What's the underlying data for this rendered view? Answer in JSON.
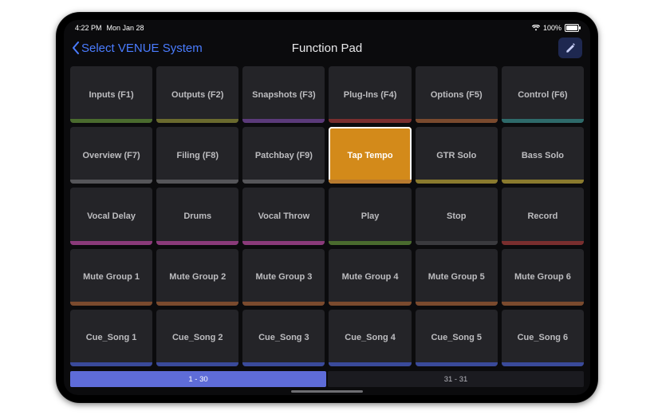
{
  "statusbar": {
    "time": "4:22 PM",
    "date": "Mon Jan 28",
    "battery_pct": "100%"
  },
  "nav": {
    "back_label": "Select VENUE System",
    "title": "Function Pad"
  },
  "colors": {
    "green": "#4a6b2e",
    "olive": "#6a6a2e",
    "purple": "#5b3a7a",
    "red": "#7a2e2e",
    "brown": "#7a4a2e",
    "teal": "#2e6a6a",
    "grey": "#555559",
    "yellow": "#8a7a2e",
    "orange": "#b87a2e",
    "magenta": "#8a3a7a",
    "darkgrey": "#3a3a3e",
    "blue": "#3a4a9a"
  },
  "pads": [
    {
      "label": "Inputs (F1)",
      "accent": "green"
    },
    {
      "label": "Outputs (F2)",
      "accent": "olive"
    },
    {
      "label": "Snapshots (F3)",
      "accent": "purple"
    },
    {
      "label": "Plug-Ins (F4)",
      "accent": "red"
    },
    {
      "label": "Options (F5)",
      "accent": "brown"
    },
    {
      "label": "Control (F6)",
      "accent": "teal"
    },
    {
      "label": "Overview (F7)",
      "accent": "grey"
    },
    {
      "label": "Filing (F8)",
      "accent": "grey"
    },
    {
      "label": "Patchbay (F9)",
      "accent": "grey"
    },
    {
      "label": "Tap Tempo",
      "accent": "orange",
      "selected": true
    },
    {
      "label": "GTR Solo",
      "accent": "yellow"
    },
    {
      "label": "Bass Solo",
      "accent": "yellow"
    },
    {
      "label": "Vocal Delay",
      "accent": "magenta"
    },
    {
      "label": "Drums",
      "accent": "magenta"
    },
    {
      "label": "Vocal Throw",
      "accent": "magenta"
    },
    {
      "label": "Play",
      "accent": "green"
    },
    {
      "label": "Stop",
      "accent": "darkgrey"
    },
    {
      "label": "Record",
      "accent": "red"
    },
    {
      "label": "Mute Group 1",
      "accent": "brown"
    },
    {
      "label": "Mute Group 2",
      "accent": "brown"
    },
    {
      "label": "Mute Group 3",
      "accent": "brown"
    },
    {
      "label": "Mute Group 4",
      "accent": "brown"
    },
    {
      "label": "Mute Group 5",
      "accent": "brown"
    },
    {
      "label": "Mute Group 6",
      "accent": "brown"
    },
    {
      "label": "Cue_Song 1",
      "accent": "blue"
    },
    {
      "label": "Cue_Song 2",
      "accent": "blue"
    },
    {
      "label": "Cue_Song 3",
      "accent": "blue"
    },
    {
      "label": "Cue_Song 4",
      "accent": "blue"
    },
    {
      "label": "Cue_Song 5",
      "accent": "blue"
    },
    {
      "label": "Cue_Song 6",
      "accent": "blue"
    }
  ],
  "pager": [
    {
      "label": "1 - 30",
      "active": true
    },
    {
      "label": "31 - 31",
      "active": false
    }
  ]
}
